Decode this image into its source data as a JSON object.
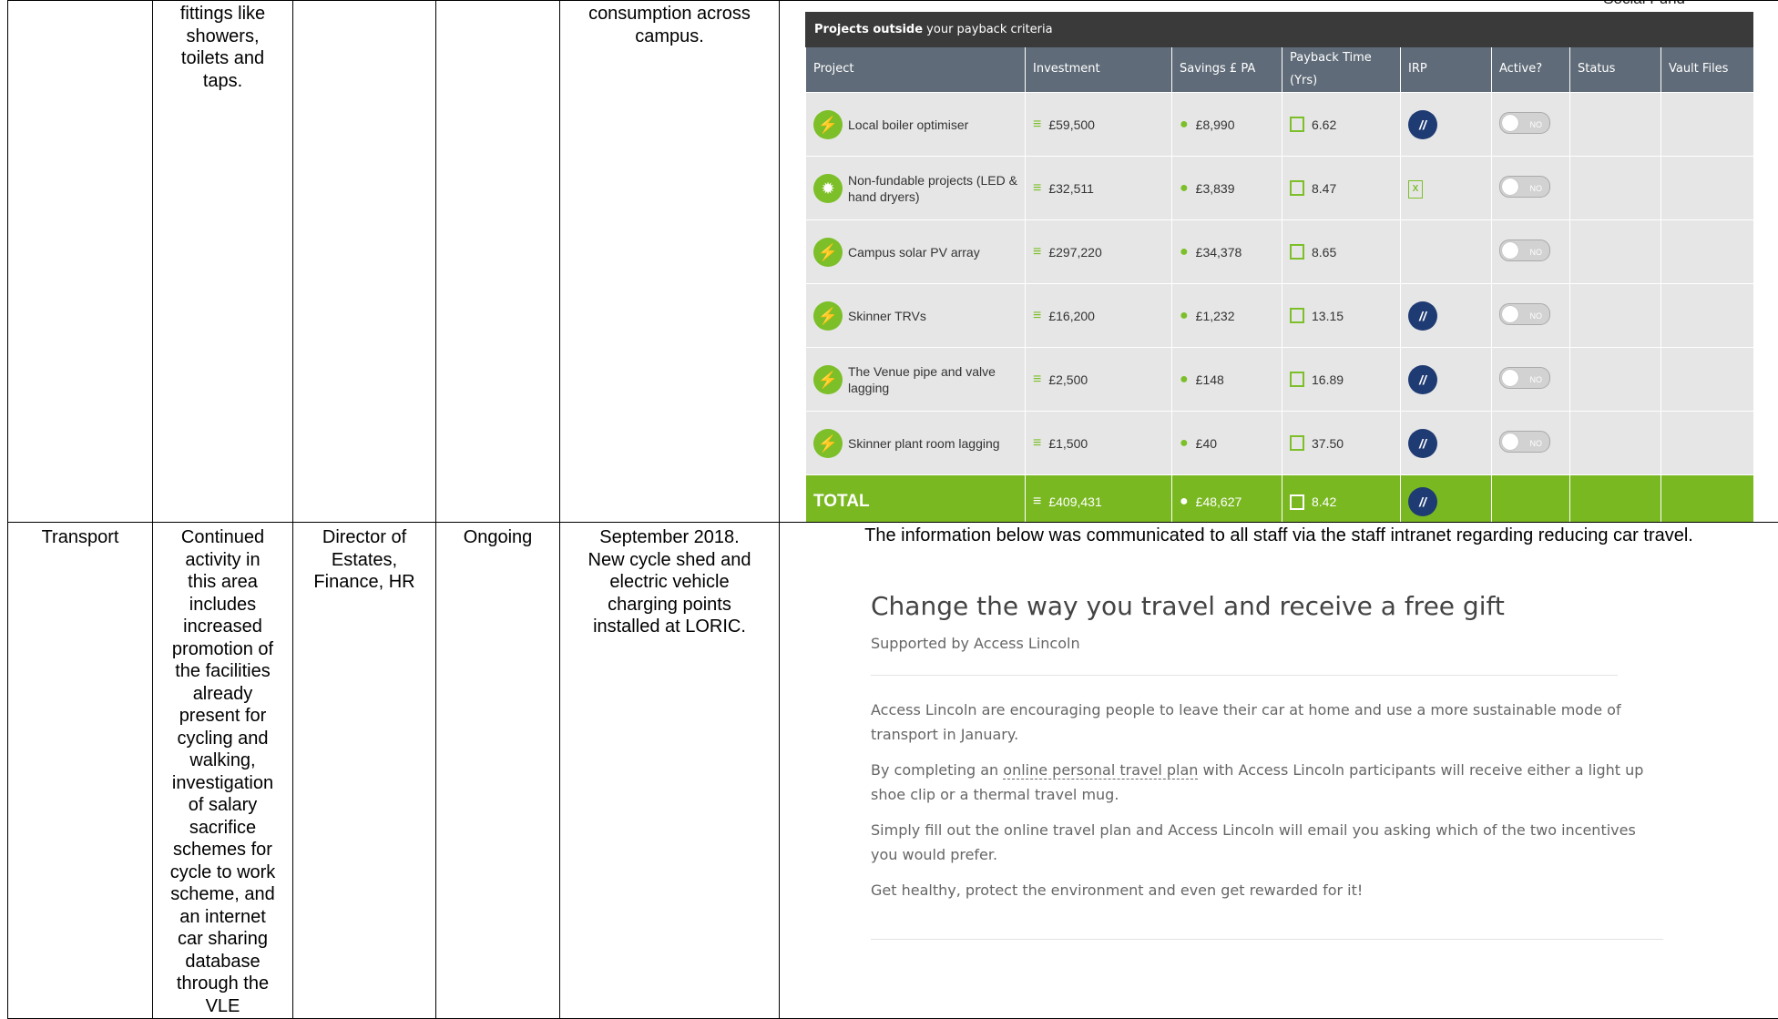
{
  "corner_text": "Social Fund",
  "row1": {
    "col2": "fittings like\nshowers,\ntoilets and\ntaps.",
    "col3": "",
    "col4": "",
    "col5": "consumption across\ncampus."
  },
  "payback_panel": {
    "title_bold": "Projects outside",
    "title_rest": " your payback criteria",
    "headers": [
      "Project",
      "Investment",
      "Savings £ PA",
      "Payback Time (Yrs)",
      "IRP",
      "Active?",
      "Status",
      "Vault Files"
    ],
    "rows": [
      {
        "project": "Local boiler optimiser",
        "investment": "£59,500",
        "savings": "£8,990",
        "payback": "6.62",
        "irp": "icon",
        "active": "NO"
      },
      {
        "project": "Non-fundable projects (LED & hand dryers)",
        "investment": "£32,511",
        "savings": "£3,839",
        "payback": "8.47",
        "irp": "excel",
        "active": "NO"
      },
      {
        "project": "Campus solar PV array",
        "investment": "£297,220",
        "savings": "£34,378",
        "payback": "8.65",
        "irp": "none",
        "active": "NO"
      },
      {
        "project": "Skinner TRVs",
        "investment": "£16,200",
        "savings": "£1,232",
        "payback": "13.15",
        "irp": "icon",
        "active": "NO"
      },
      {
        "project": "The Venue pipe and valve lagging",
        "investment": "£2,500",
        "savings": "£148",
        "payback": "16.89",
        "irp": "icon",
        "active": "NO"
      },
      {
        "project": "Skinner plant room lagging",
        "investment": "£1,500",
        "savings": "£40",
        "payback": "37.50",
        "irp": "icon",
        "active": "NO"
      }
    ],
    "total": {
      "label": "TOTAL",
      "investment": "£409,431",
      "savings": "£48,627",
      "payback": "8.42"
    }
  },
  "row2": {
    "col1": "Transport",
    "col2": "Continued\nactivity in\nthis area\nincludes\nincreased\npromotion of\nthe facilities\nalready\npresent for\ncycling and\nwalking,\ninvestigation\nof salary\nsacrifice\nschemes for\ncycle to work\nscheme, and\nan internet\ncar sharing\ndatabase\nthrough the\nVLE",
    "col3": "Director of\nEstates,\nFinance, HR",
    "col4": "Ongoing",
    "col5": "September 2018.\nNew cycle shed and\nelectric vehicle\ncharging points\ninstalled at LORIC."
  },
  "notice": {
    "intro": "The information below was communicated to all staff via the staff intranet regarding reducing car travel.",
    "heading": "Change the way you travel and receive a free gift",
    "subheading": "Supported by Access Lincoln",
    "p1": "Access Lincoln are encouraging people to leave their car at home and use a more sustainable mode of transport in January.",
    "p2_before": "By completing an ",
    "p2_link": "online personal travel plan",
    "p2_after": " with Access Lincoln participants will receive either a light up shoe clip  or a thermal travel mug.",
    "p3": "Simply fill out the online travel plan and Access Lincoln will email you asking which of the two incentives you would prefer.",
    "p4": "Get healthy, protect the environment and even get rewarded for it!"
  }
}
